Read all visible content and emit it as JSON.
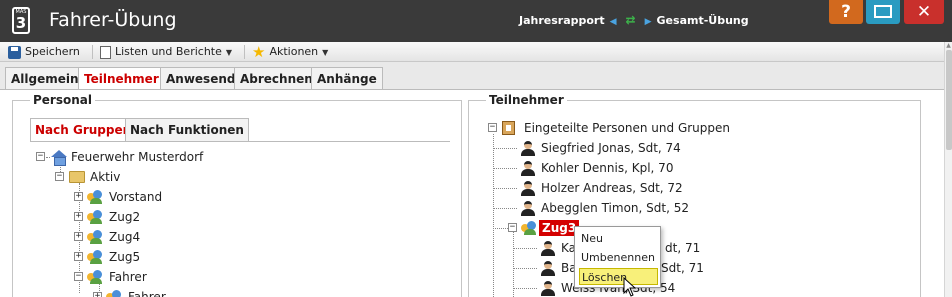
{
  "app": {
    "logo_small": "MAS",
    "logo_number": "3",
    "title": "Fahrer-Übung",
    "breadcrumb": {
      "left": "Jahresrapport",
      "right": "Gesamt-Übung"
    },
    "buttons": {
      "help": "?",
      "close": "✕"
    }
  },
  "toolbar": {
    "save": "Speichern",
    "lists": "Listen und Berichte",
    "actions": "Aktionen"
  },
  "tabs": [
    "Allgemein",
    "Teilnehmer",
    "Anwesend",
    "Abrechnen",
    "Anhänge"
  ],
  "active_tab": "Teilnehmer",
  "personal": {
    "legend": "Personal",
    "subtabs": [
      "Nach Gruppen",
      "Nach Funktionen"
    ],
    "active_subtab": "Nach Gruppen",
    "tree": [
      {
        "label": "Feuerwehr Musterdorf",
        "icon": "house-icon",
        "expander": "−"
      },
      {
        "label": "Aktiv",
        "icon": "folder-icon",
        "expander": "−"
      },
      {
        "label": "Vorstand",
        "icon": "group-icon",
        "expander": "+"
      },
      {
        "label": "Zug2",
        "icon": "group-icon",
        "expander": "+"
      },
      {
        "label": "Zug4",
        "icon": "group-icon",
        "expander": "+"
      },
      {
        "label": "Zug5",
        "icon": "group-icon",
        "expander": "+"
      },
      {
        "label": "Fahrer",
        "icon": "group-icon",
        "expander": "−"
      },
      {
        "label": "Fahrer",
        "icon": "group-icon",
        "expander": "+"
      }
    ]
  },
  "teilnehmer": {
    "legend": "Teilnehmer",
    "root": "Eingeteilte Personen und Gruppen",
    "persons": [
      "Siegfried Jonas, Sdt, 74",
      "Kohler Dennis, Kpl, 70",
      "Holzer Andreas, Sdt, 72",
      "Abegglen Timon, Sdt, 52"
    ],
    "group": "Zug3",
    "group_persons": [
      "Ka",
      "dt, 71",
      "Ba",
      "Sdt, 71",
      "Weiss Ivan, Sdt, 54"
    ]
  },
  "context_menu": {
    "items": [
      "Neu",
      "Umbenennen",
      "Löschen"
    ],
    "hovered": "Löschen"
  },
  "colors": {
    "titlebar": "#3a3a3a",
    "accent_red": "#cc0000",
    "help": "#d2691e",
    "maximize": "#2a9bc1",
    "close": "#c9302c"
  }
}
